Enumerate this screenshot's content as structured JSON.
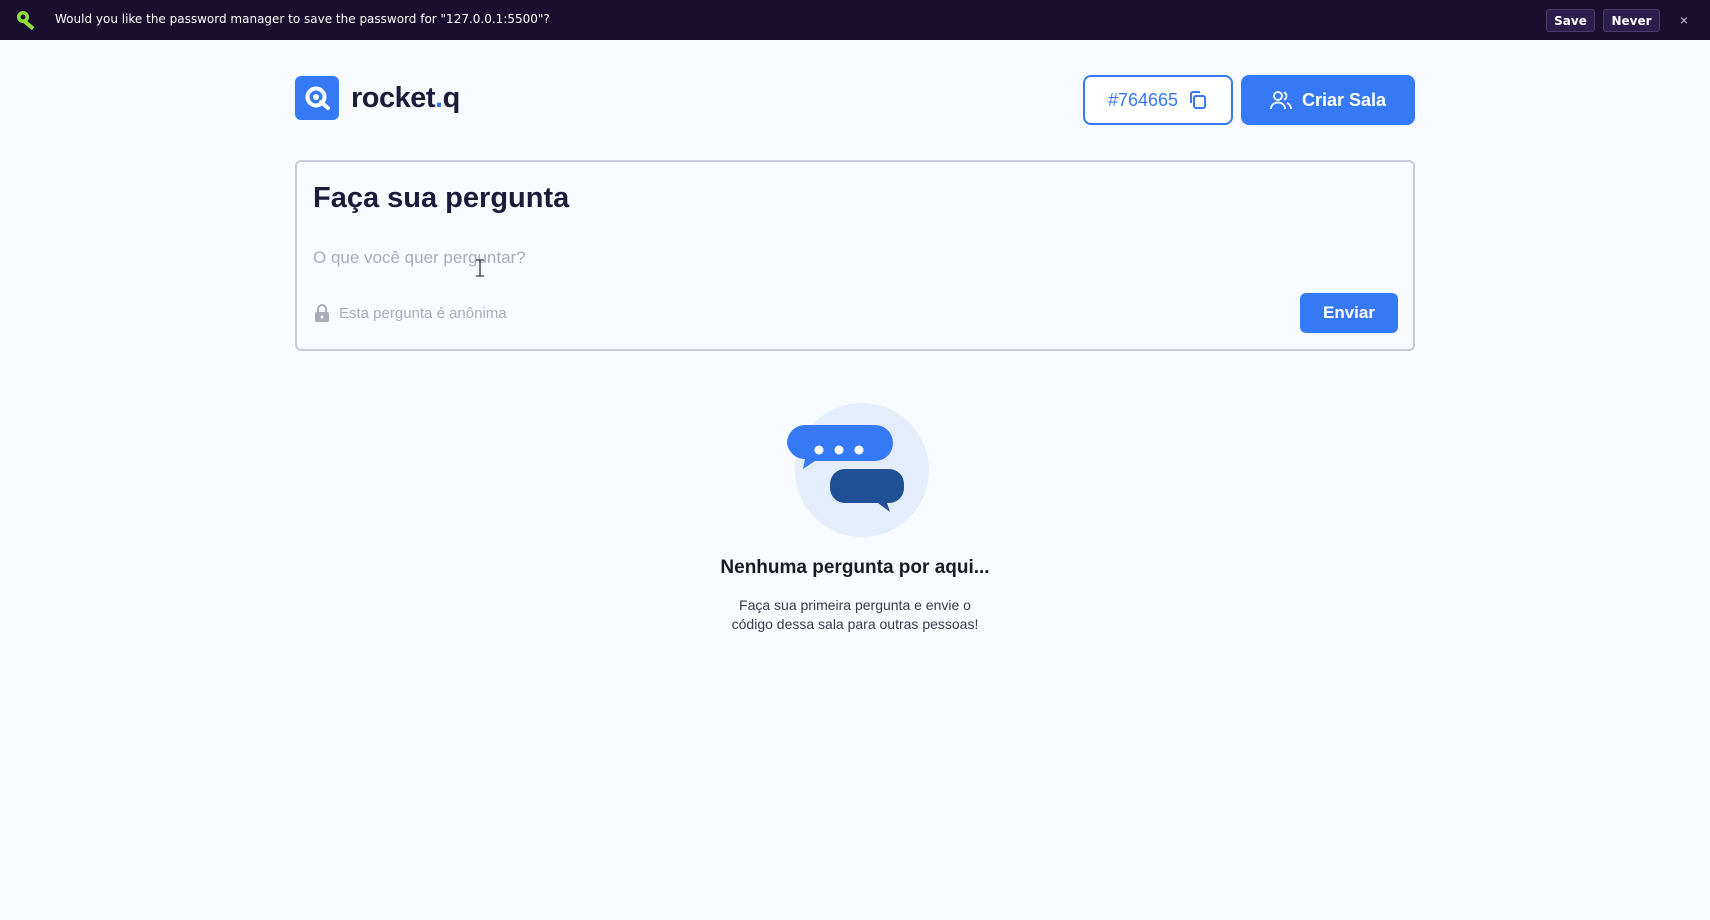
{
  "password_bar": {
    "message": "Would you like the password manager to save the password for \"127.0.0.1:5500\"?",
    "save_label": "Save",
    "never_label": "Never",
    "close_label": "×"
  },
  "header": {
    "logo_text": "rocket",
    "logo_dot": ".",
    "logo_suffix": "q",
    "room_code": "#764665",
    "create_room_label": "Criar Sala"
  },
  "question_form": {
    "title": "Faça sua pergunta",
    "input_placeholder": "O que você quer perguntar?",
    "anonymous_label": "Esta pergunta é anônima",
    "submit_label": "Enviar"
  },
  "empty_state": {
    "title": "Nenhuma pergunta por aqui...",
    "description_line1": "Faça sua primeira pergunta e envie o",
    "description_line2": "código dessa sala para outras pessoas!"
  },
  "colors": {
    "accent": "#3579f6",
    "topbar_bg": "#1a0f2e",
    "page_bg": "#f8fbff",
    "title_text": "#1b1b3a",
    "dark_bubble": "#1f4f94"
  }
}
